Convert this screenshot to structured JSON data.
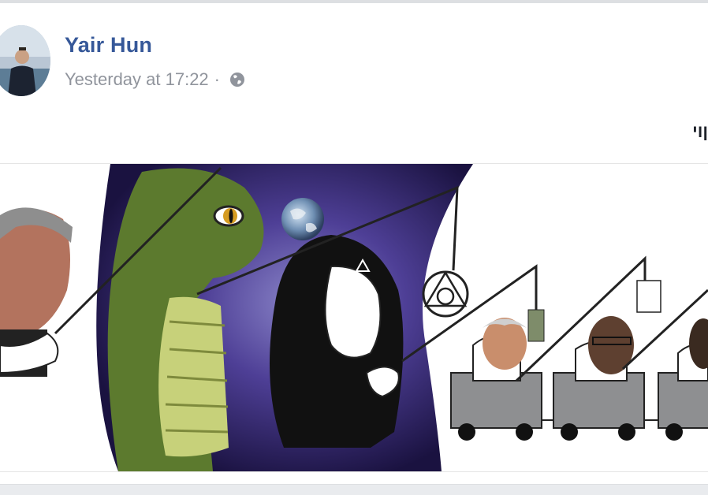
{
  "post": {
    "author_name": "Yair Hun",
    "timestamp": "Yesterday at 17:22",
    "separator": "·",
    "privacy_icon": "globe-icon",
    "text": "ןוי"
  },
  "colors": {
    "author_link": "#365899",
    "meta_text": "#90949c",
    "background": "#e9ebee"
  }
}
